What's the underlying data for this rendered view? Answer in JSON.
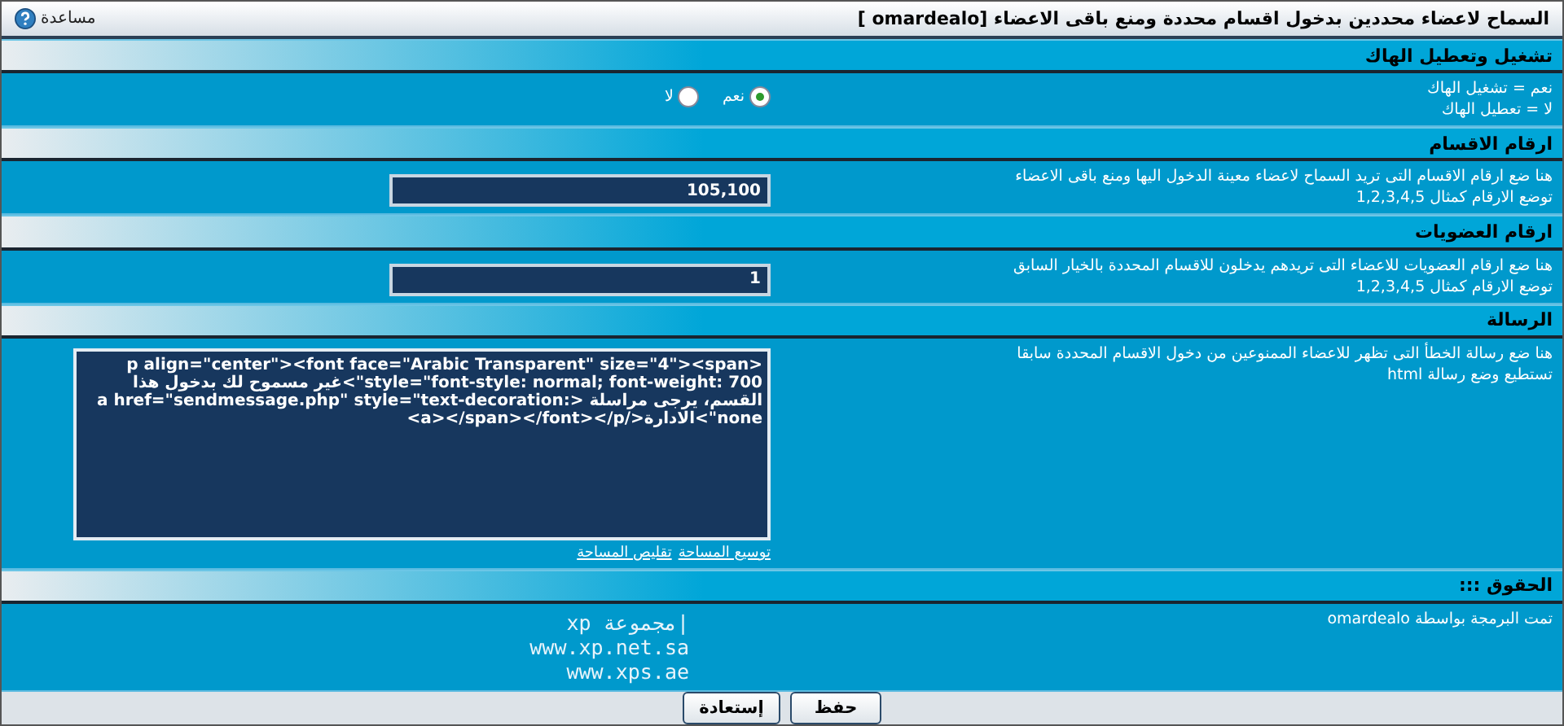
{
  "window": {
    "title": "السماح لاعضاء محددين بدخول اقسام محددة ومنع باقى الاعضاء [omardealo ]",
    "help_link": "مساعدة"
  },
  "sections": [
    {
      "kind": "radio",
      "title": "تشغيل وتعطيل الهاك",
      "description": [
        "نعم = تشغيل الهاك",
        "لا = تعطيل الهاك"
      ],
      "options": [
        {
          "label": "نعم",
          "selected": true
        },
        {
          "label": "لا",
          "selected": false
        }
      ]
    },
    {
      "kind": "input",
      "title": "ارقام الاقسام",
      "description": [
        "هنا ضع ارقام الاقسام التى تريد السماح لاعضاء معينة الدخول اليها ومنع باقى الاعضاء",
        "توضع الارقام كمثال 1,2,3,4,5"
      ],
      "value": "105,100"
    },
    {
      "kind": "input",
      "title": "ارقام العضويات",
      "description": [
        "هنا ضع ارقام العضويات للاعضاء التى تريدهم يدخلون للاقسام المحددة بالخيار السابق",
        "توضع الارقام كمثال 1,2,3,4,5"
      ],
      "value": "1"
    },
    {
      "kind": "textarea",
      "title": "الرسالة",
      "description": [
        "هنا ضع رسالة الخطأ التى تظهر للاعضاء الممنوعين من دخول الاقسام المحددة سابقا",
        "تستطيع وضع رسالة html"
      ],
      "value": "<p align=\"center\"><font face=\"Arabic Transparent\" size=\"4\"><span style=\"font-style: normal; font-weight: 700\">غير مسموح لك بدخول هذا القسم، يرجى مراسلة <a href=\"sendmessage.php\" style=\"text-decoration: none\">الادارة</a></span></font></p>",
      "links": [
        "توسيع المساحة",
        "تقليص المساحة"
      ]
    },
    {
      "kind": "credits",
      "title": "الحقوق :::",
      "description": [
        "تمت البرمجة بواسطة omardealo"
      ],
      "lines": [
        "|مجموعة xp",
        "www.xp.net.sa",
        "www.xps.ae"
      ]
    }
  ],
  "buttons": [
    "حفظ",
    "إستعادة"
  ]
}
